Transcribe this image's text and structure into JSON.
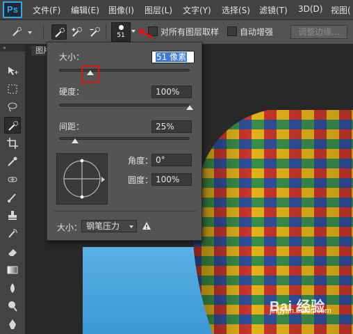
{
  "app": {
    "logo": "Ps"
  },
  "menu": [
    "文件(F)",
    "编辑(E)",
    "图像(I)",
    "图层(L)",
    "文字(Y)",
    "选择(S)",
    "滤镜(T)",
    "3D(D)",
    "视图("
  ],
  "options_bar": {
    "brush_size": "51",
    "sample_all_layers_label": "对所有图层取样",
    "auto_enhance_label": "自动增强",
    "refine_edge_label": "调整边缘..."
  },
  "document": {
    "tab_label": "图片"
  },
  "brush_panel": {
    "size_label": "大小：",
    "size_value": "51 像素",
    "size_fraction": 0.24,
    "hardness_label": "硬度：",
    "hardness_value": "100%",
    "spacing_label": "间距：",
    "spacing_value": "25%",
    "angle_label": "角度：",
    "angle_value": "0°",
    "roundness_label": "圆度：",
    "roundness_value": "100%",
    "footer_size_label": "大小：",
    "pressure_option": "钢笔压力"
  },
  "watermark": {
    "main": "Bai 经验",
    "sub": "jingyan.baidu.com"
  },
  "colors": {
    "accent_blue": "#35a8e8",
    "highlight_red": "#e3120f",
    "sky": "#4aa6de"
  },
  "icons": [
    "quick-selection-icon",
    "brush-icon",
    "move-icon",
    "marquee-icon",
    "lasso-icon",
    "crop-icon",
    "eyedropper-icon",
    "healing-icon",
    "stamp-icon",
    "eraser-icon",
    "gradient-icon",
    "blur-icon",
    "dodge-icon",
    "pen-icon",
    "warning-icon",
    "arrow-icon"
  ]
}
